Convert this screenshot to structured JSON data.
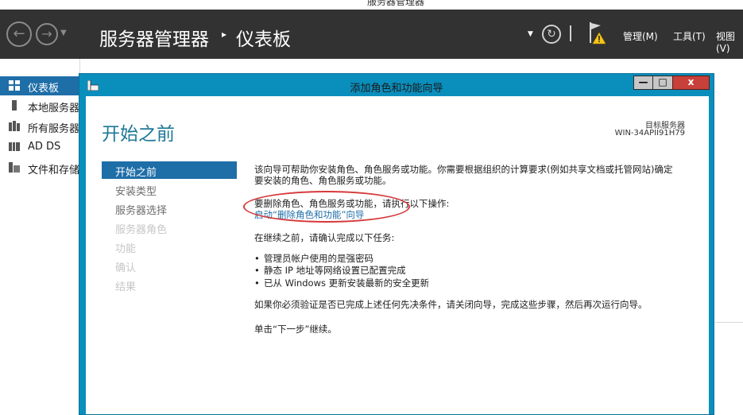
{
  "window_title": "服务器管理器",
  "header": {
    "breadcrumb_root": "服务器管理器",
    "breadcrumb_sep": "▸",
    "breadcrumb_page": "仪表板",
    "menus": [
      "管理(M)",
      "工具(T)",
      "视图(V)"
    ]
  },
  "sidebar": {
    "items": [
      {
        "label": "仪表板",
        "selected": true
      },
      {
        "label": "本地服务器"
      },
      {
        "label": "所有服务器"
      },
      {
        "label": "AD DS"
      },
      {
        "label": "文件和存储服务"
      }
    ]
  },
  "wizard": {
    "title": "添加角色和功能向导",
    "heading": "开始之前",
    "target_label": "目标服务器",
    "target_value": "WIN-34APII91H79",
    "steps": [
      {
        "label": "开始之前",
        "state": "active"
      },
      {
        "label": "安装类型",
        "state": "done"
      },
      {
        "label": "服务器选择",
        "state": "done"
      },
      {
        "label": "服务器角色",
        "state": "disabled"
      },
      {
        "label": "功能",
        "state": "disabled"
      },
      {
        "label": "确认",
        "state": "disabled"
      },
      {
        "label": "结果",
        "state": "disabled"
      }
    ],
    "intro_line1": "该向导可帮助你安装角色、角色服务或功能。你需要根据组织的计算要求(例如共享文档或托管网站)确定",
    "intro_line2": "要安装的角色、角色服务或功能。",
    "remove_text": "要删除角色、角色服务或功能，请执行以下操作:",
    "remove_link": "启动“删除角色和功能”向导",
    "before_text": "在继续之前，请确认完成以下任务:",
    "bullets": [
      "管理员帐户使用的是强密码",
      "静态 IP 地址等网络设置已配置完成",
      "已从 Windows 更新安装最新的安全更新"
    ],
    "verify_text": "如果你必须验证是否已完成上述任何先决条件，请关闭向导，完成这些步骤，然后再次运行向导。",
    "continue_text": "单击“下一步”继续。"
  },
  "colors": {
    "header_bg": "#323232",
    "selection_blue": "#1e6ea8",
    "wizard_frame": "#0a8ebc",
    "heading_teal": "#1e7898",
    "annotation_red": "#d6393b"
  },
  "icons": [
    "back-arrow-icon",
    "forward-arrow-icon",
    "refresh-icon",
    "flag-warning-icon",
    "dashboard-icon",
    "server-icon",
    "servers-icon",
    "ad-ds-icon",
    "file-storage-icon",
    "wizard-app-icon"
  ]
}
